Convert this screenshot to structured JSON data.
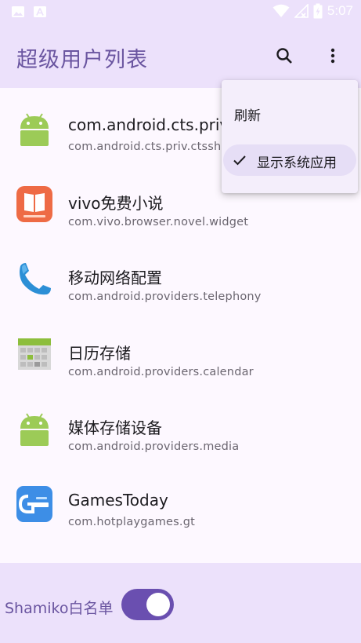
{
  "status_bar": {
    "time": "5:07"
  },
  "app_bar": {
    "title": "超级用户列表"
  },
  "apps": [
    {
      "name": "com.android.cts.priv",
      "package": "com.android.cts.priv.ctssh",
      "icon": "android-icon"
    },
    {
      "name": "vivo免费小说",
      "package": "com.vivo.browser.novel.widget",
      "icon": "book-app-icon"
    },
    {
      "name": "移动网络配置",
      "package": "com.android.providers.telephony",
      "icon": "phone-icon"
    },
    {
      "name": "日历存储",
      "package": "com.android.providers.calendar",
      "icon": "calendar-icon"
    },
    {
      "name": "媒体存储设备",
      "package": "com.android.providers.media",
      "icon": "android-icon"
    },
    {
      "name": "GamesToday",
      "package": "com.hotplaygames.gt",
      "icon": "gamestoday-icon"
    }
  ],
  "menu": {
    "items": [
      {
        "label": "刷新",
        "checked": false
      },
      {
        "label": "显示系统应用",
        "checked": true
      }
    ]
  },
  "bottom_bar": {
    "switch_label": "Shamiko白名单",
    "switch_on": true
  },
  "colors": {
    "accent": "#6a4fb0",
    "bar": "#ece1fb",
    "title": "#6a55a0"
  }
}
